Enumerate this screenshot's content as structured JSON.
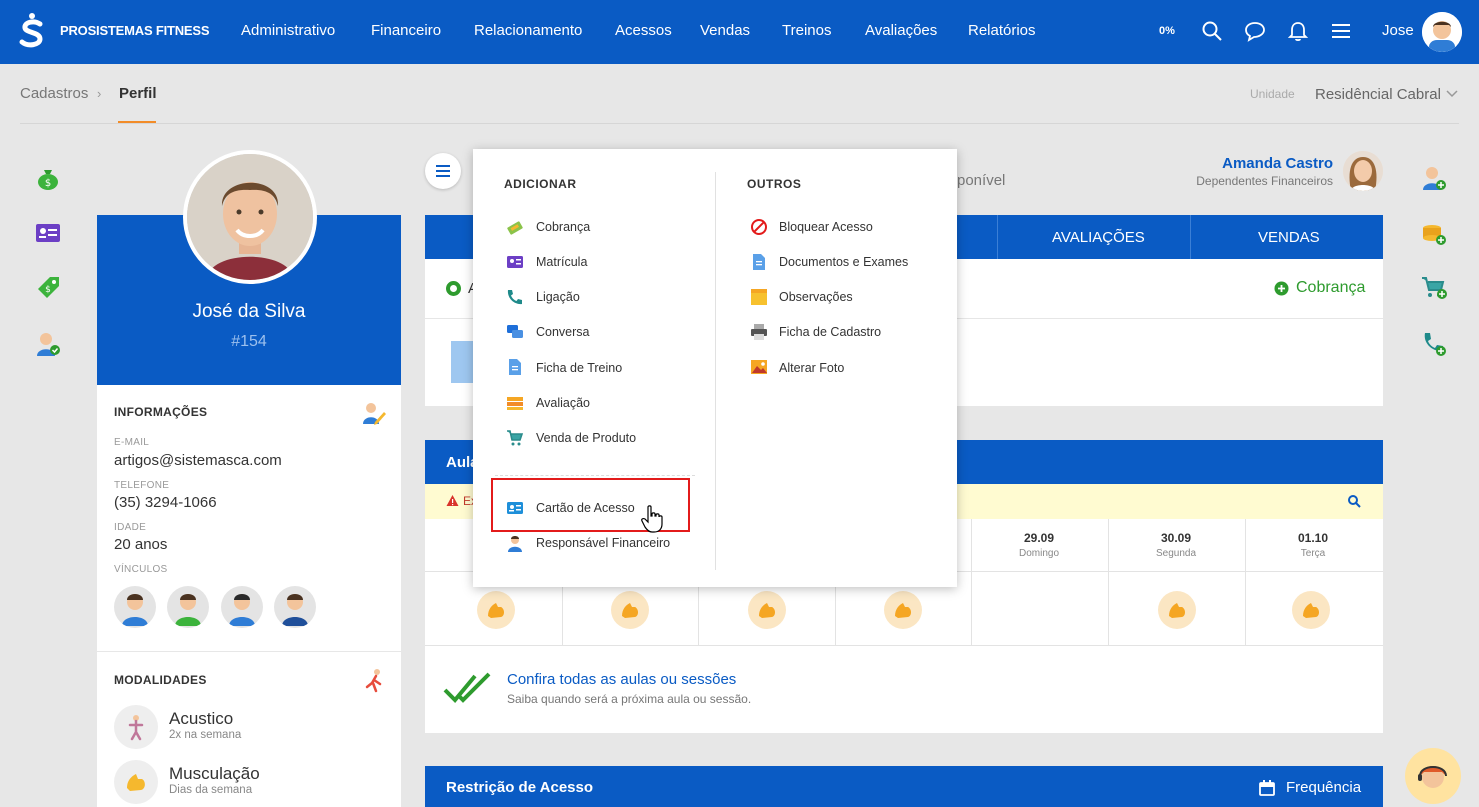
{
  "app": {
    "brand": "PROSISTEMAS FITNESS"
  },
  "nav": [
    "Administrativo",
    "Financeiro",
    "Relacionamento",
    "Acessos",
    "Vendas",
    "Treinos",
    "Avaliações",
    "Relatórios"
  ],
  "topbar": {
    "progress": "0%",
    "user": "Jose"
  },
  "breadcrumb": {
    "parent": "Cadastros",
    "current": "Perfil"
  },
  "unit": {
    "label": "Unidade",
    "value": "Residêncial Cabral"
  },
  "profile": {
    "name": "José da Silva",
    "id": "#154"
  },
  "info": {
    "title": "INFORMAÇÕES",
    "email_label": "E-MAIL",
    "email": "artigos@sistemasca.com",
    "phone_label": "TELEFONE",
    "phone": "(35) 3294-1066",
    "age_label": "IDADE",
    "age": "20 anos",
    "links_label": "VÍNCULOS"
  },
  "modalities": {
    "title": "MODALIDADES",
    "items": [
      {
        "name": "Acustico",
        "sub": "2x na semana"
      },
      {
        "name": "Musculação",
        "sub": "Dias da semana"
      }
    ]
  },
  "main": {
    "available_text": "ponível",
    "dependent": {
      "name": "Amanda Castro",
      "role": "Dependentes Financeiros"
    },
    "tabs": [
      "AVALIAÇÕES",
      "VENDAS"
    ],
    "status_partial": "A",
    "cobranca_link": "Cobrança",
    "aulas_title": "Aula",
    "warning_partial": "Ex",
    "days": [
      {
        "date": "29.09",
        "name": "Domingo"
      },
      {
        "date": "30.09",
        "name": "Segunda"
      },
      {
        "date": "01.10",
        "name": "Terça"
      }
    ],
    "confira_title": "Confira todas as aulas ou sessões",
    "confira_sub": "Saiba quando será a próxima aula ou sessão.",
    "restricao_title": "Restrição de Acesso",
    "frequencia": "Frequência"
  },
  "menu": {
    "adicionar_title": "ADICIONAR",
    "outros_title": "OUTROS",
    "adicionar": [
      "Cobrança",
      "Matrícula",
      "Ligação",
      "Conversa",
      "Ficha de Treino",
      "Avaliação",
      "Venda de Produto"
    ],
    "adicionar_extra": [
      "Cartão de Acesso",
      "Responsável Financeiro"
    ],
    "outros": [
      "Bloquear Acesso",
      "Documentos e Exames",
      "Observações",
      "Ficha de Cadastro",
      "Alterar Foto"
    ]
  },
  "colors": {
    "primary": "#0a5bc4",
    "accent": "#f28c28",
    "success": "#2e9b2e",
    "highlight": "#e31b1b"
  }
}
